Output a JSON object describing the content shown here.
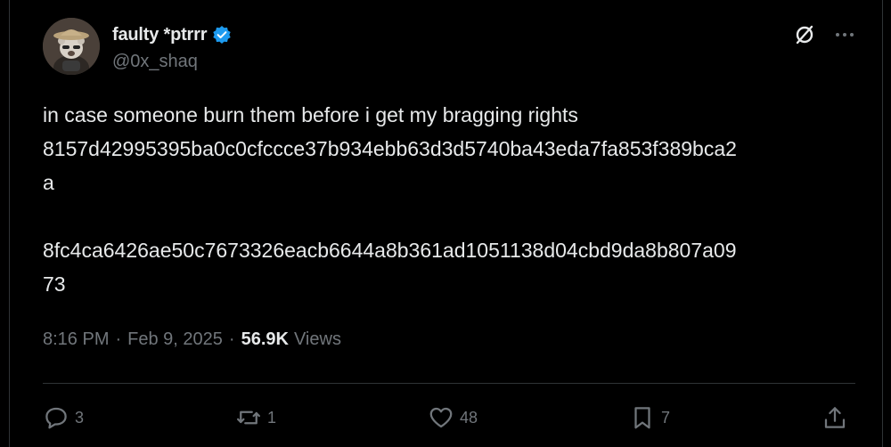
{
  "author": {
    "display_name": "faulty *ptrrr",
    "handle": "@0x_shaq",
    "verified": true,
    "avatar_icon": "bear-avatar"
  },
  "tweet": {
    "lines": [
      "in case someone burn them before i get my bragging rights",
      "8157d42995395ba0c0cfccce37b934ebb63d3d5740ba43eda7fa853f389bca2",
      "a",
      "",
      "8fc4ca6426ae50c7673326eacb6644a8b361ad1051138d04cbd9da8b807a09",
      "73"
    ]
  },
  "meta": {
    "time": "8:16 PM",
    "separator": "·",
    "date": "Feb 9, 2025",
    "views_count": "56.9K",
    "views_label": "Views"
  },
  "actions": {
    "replies": "3",
    "reposts": "1",
    "likes": "48",
    "bookmarks": "7"
  },
  "colors": {
    "background": "#000000",
    "text": "#e7e9ea",
    "muted": "#71767b",
    "verified": "#1d9bf0",
    "divider": "#2f3336"
  }
}
